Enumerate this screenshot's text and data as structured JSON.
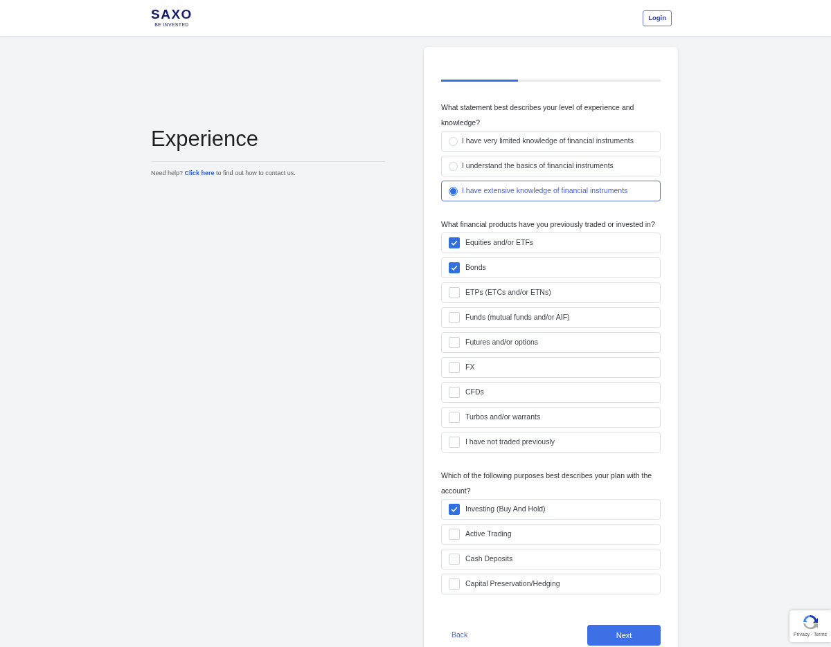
{
  "header": {
    "logo": "SAXO",
    "tagline": "BE INVESTED",
    "login": "Login"
  },
  "intro": {
    "title": "Experience",
    "help_prefix": "Need help?",
    "help_link": "Click here",
    "help_suffix": "to find out how to contact us."
  },
  "progress": {
    "level": 0.35
  },
  "questions": [
    {
      "kind": "radio",
      "text": "What statement best describes your level of experience and knowledge?",
      "options": [
        {
          "label": "I have very limited knowledge of financial instruments",
          "selected": false
        },
        {
          "label": "I understand the basics of financial instruments",
          "selected": false
        },
        {
          "label": "I have extensive knowledge of financial instruments",
          "selected": true
        }
      ]
    },
    {
      "kind": "checkbox",
      "text": "What financial products have you previously traded or invested in?",
      "options": [
        {
          "label": "Equities and/or ETFs",
          "checked": true
        },
        {
          "label": "Bonds",
          "checked": true
        },
        {
          "label": "ETPs (ETCs and/or ETNs)",
          "checked": false
        },
        {
          "label": "Funds (mutual funds and/or AIF)",
          "checked": false
        },
        {
          "label": "Futures and/or options",
          "checked": false
        },
        {
          "label": "FX",
          "checked": false
        },
        {
          "label": "CFDs",
          "checked": false
        },
        {
          "label": "Turbos and/or warrants",
          "checked": false
        },
        {
          "label": "I have not traded previously",
          "checked": false
        }
      ]
    },
    {
      "kind": "checkbox",
      "text": "Which of the following purposes best describes your plan with the account?",
      "options": [
        {
          "label": "Investing (Buy And Hold)",
          "checked": true
        },
        {
          "label": "Active Trading",
          "checked": false
        },
        {
          "label": "Cash Deposits",
          "checked": false
        },
        {
          "label": "Capital Preservation/Hedging",
          "checked": false
        }
      ]
    }
  ],
  "actions": {
    "back": "Back",
    "next": "Next"
  },
  "recaptcha": {
    "links": "Privacy - Terms"
  }
}
